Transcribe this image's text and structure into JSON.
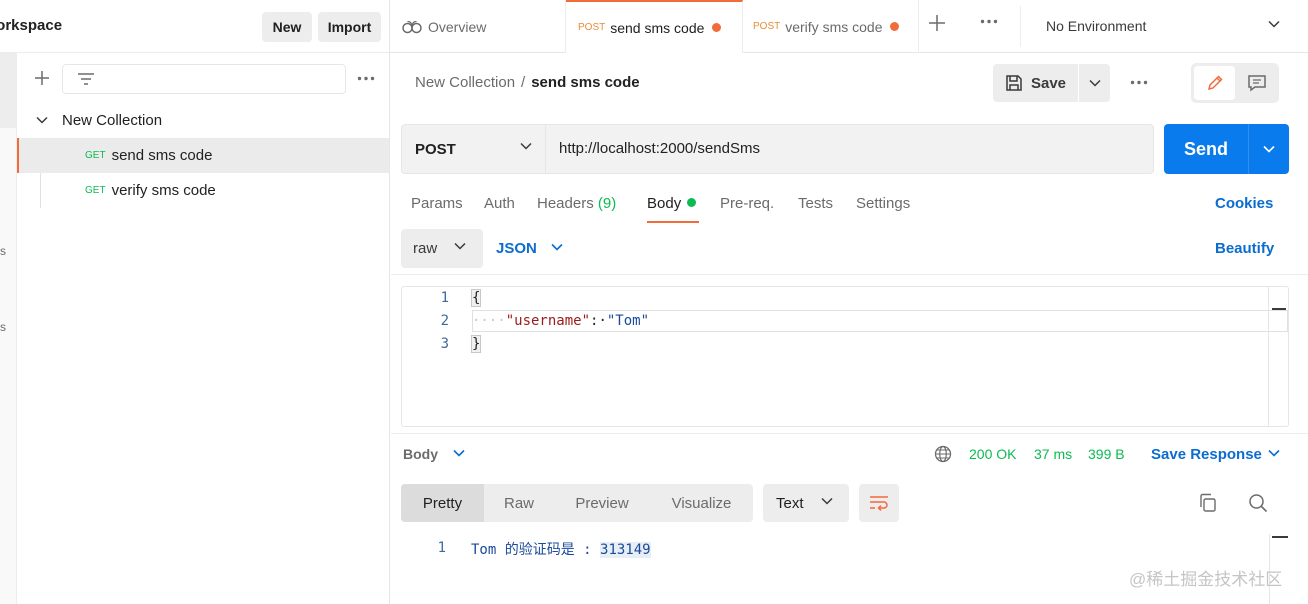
{
  "sidebar": {
    "workspace_title": "/orkspace",
    "new_label": "New",
    "import_label": "Import",
    "rail_chars": [
      "s",
      "s"
    ],
    "collection_name": "New Collection",
    "requests": [
      {
        "method": "GET",
        "name": "send sms code"
      },
      {
        "method": "GET",
        "name": "verify sms code"
      }
    ]
  },
  "tabs": {
    "overview_label": "Overview",
    "items": [
      {
        "method": "POST",
        "name": "send sms code"
      },
      {
        "method": "POST",
        "name": "verify sms code"
      }
    ],
    "environment": "No Environment"
  },
  "request": {
    "breadcrumb_collection": "New Collection",
    "breadcrumb_separator": "/",
    "breadcrumb_request": "send sms code",
    "save_label": "Save",
    "method": "POST",
    "url": "http://localhost:2000/sendSms",
    "send_label": "Send",
    "tabs": {
      "params": "Params",
      "auth": "Auth",
      "headers": "Headers",
      "headers_count": "(9)",
      "body": "Body",
      "prereq": "Pre-req.",
      "tests": "Tests",
      "settings": "Settings"
    },
    "cookies_label": "Cookies",
    "body_mode": "raw",
    "body_language": "JSON",
    "beautify_label": "Beautify",
    "body_lines": {
      "line_numbers": [
        "1",
        "2",
        "3"
      ],
      "open_brace": "{",
      "indent_dots": "····",
      "key": "\"username\"",
      "colon": ":·",
      "value": "\"Tom\"",
      "close_brace": "}"
    }
  },
  "response": {
    "body_label": "Body",
    "status": "200 OK",
    "time": "37 ms",
    "size": "399 B",
    "save_response_label": "Save Response",
    "view_tabs": {
      "pretty": "Pretty",
      "raw": "Raw",
      "preview": "Preview",
      "visualize": "Visualize"
    },
    "format": "Text",
    "line_number": "1",
    "text": "Tom 的验证码是 : ",
    "code": "313149"
  },
  "watermark": "@稀土掘金技术社区",
  "colors": {
    "accent_orange": "#f26b3a",
    "send_blue": "#097bed",
    "link_blue": "#0b6dcf",
    "success_green": "#0cbb52"
  }
}
